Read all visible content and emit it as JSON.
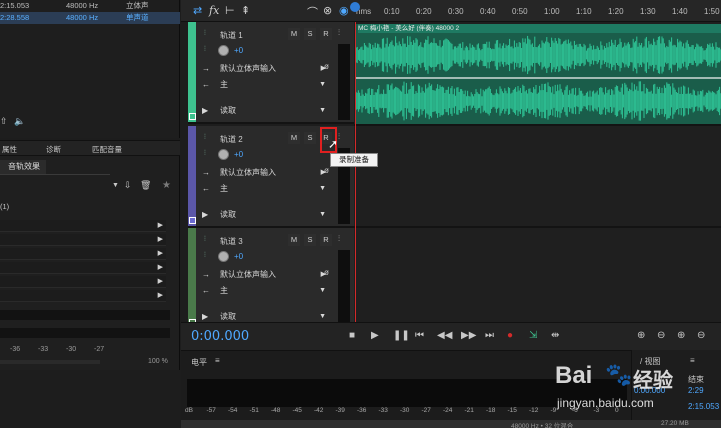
{
  "files": {
    "rows": [
      {
        "dur": "2:15.053",
        "rate": "48000 Hz",
        "ch": "立体声",
        "selected": false
      },
      {
        "dur": "2:28.558",
        "rate": "48000 Hz",
        "ch": "单声道",
        "selected": true
      }
    ]
  },
  "left_tabs": [
    "属性",
    "诊断",
    "匹配音量"
  ],
  "fx_panel": {
    "title": "音轨效果",
    "label": "(1)"
  },
  "toolbar": {
    "fx_label": "fx",
    "ruler_unit": "hms"
  },
  "ruler_ticks": [
    "0:10",
    "0:20",
    "0:30",
    "0:40",
    "0:50",
    "1:00",
    "1:10",
    "1:20",
    "1:30",
    "1:40",
    "1:50"
  ],
  "tracks": [
    {
      "name": "轨道 1",
      "volume": "+0",
      "input": "默认立体声输入",
      "output": "主",
      "mode": "读取",
      "stripe": "#3ec28f",
      "badge": "#3ec28f"
    },
    {
      "name": "轨道 2",
      "volume": "+0",
      "input": "默认立体声输入",
      "output": "主",
      "mode": "读取",
      "stripe": "#5b57a8",
      "badge": "#6b6bd0"
    },
    {
      "name": "轨道 3",
      "volume": "+0",
      "input": "默认立体声输入",
      "output": "主",
      "mode": "读取",
      "stripe": "#4a7a4a",
      "badge": "#4a7a4a"
    }
  ],
  "track_buttons": {
    "mute": "M",
    "solo": "S",
    "record": "R"
  },
  "clip1": {
    "title": "MC 梅小艳 - 美么好 (伴奏) 48000 2"
  },
  "tooltip": {
    "text": "录制准备"
  },
  "transport": {
    "time": "0:00.000"
  },
  "level_panel": {
    "title": "电平"
  },
  "level_scale": [
    "dB",
    "-57",
    "-54",
    "-51",
    "-48",
    "-45",
    "-42",
    "-39",
    "-36",
    "-33",
    "-30",
    "-27",
    "-24",
    "-21",
    "-18",
    "-15",
    "-12",
    "-9",
    "-6",
    "-3",
    "0"
  ],
  "left_scale": [
    "-36",
    "-33",
    "-30",
    "-27"
  ],
  "left_scale_pct": "100 %",
  "selection_panel": {
    "title": "/ 视图",
    "end_label": "结束",
    "start_value": "0:00.000",
    "end_value": "2:15.053",
    "end_label2": "2:29"
  },
  "status_bar": {
    "format": "48000 Hz • 32 位混合",
    "size": "27.20 MB"
  },
  "watermark": {
    "brand": "Bai",
    "brand2": "经验",
    "url": "jingyan.baidu.com"
  },
  "colors": {
    "accent": "#4fa8ff",
    "waveform": "#2fc597",
    "record_red": "#d42a2a"
  }
}
